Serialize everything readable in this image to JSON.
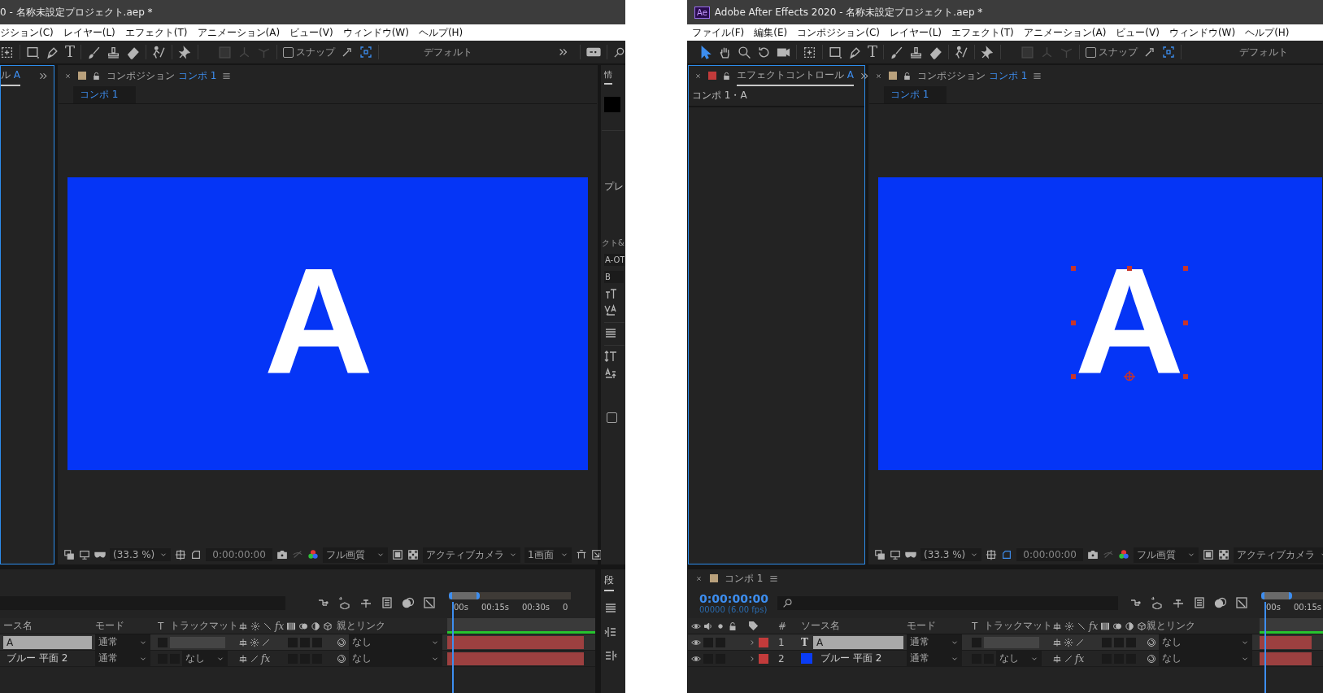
{
  "screens": [
    {
      "title": "0 - 名称未設定プロジェクト.aep *",
      "menu": [
        "ジション(C)",
        "レイヤー(L)",
        "エフェクト(T)",
        "アニメーション(A)",
        "ビュー(V)",
        "ウィンドウ(W)",
        "ヘルプ(H)"
      ],
      "tools": [
        {
          "kind": "region",
          "selected": false
        },
        {
          "kind": "rect",
          "selected": false
        },
        {
          "kind": "pen",
          "selected": false
        },
        {
          "kind": "type",
          "text": "T",
          "selected": false
        },
        {
          "kind": "brush",
          "selected": false
        },
        {
          "kind": "stamp",
          "selected": false
        },
        {
          "kind": "eraser",
          "selected": false
        },
        {
          "kind": "roto",
          "selected": false
        },
        {
          "kind": "pin",
          "selected": false
        }
      ],
      "snap": {
        "label": "スナップ",
        "checked": false
      },
      "workspace": "デフォルト",
      "left_panel": {
        "tab": "ル",
        "layer": "A",
        "active": true
      },
      "comp_tab": {
        "title": "コンポジション",
        "comp": "コンポ 1",
        "active": false
      },
      "comp_subtab": "コンポ 1",
      "layer_text": "A",
      "layer_selected": false,
      "viewer_bar": {
        "zoom": "(33.3 %)",
        "time": "0:00:00:00",
        "quality": "フル画質",
        "camera": "アクティブカメラ",
        "views": "1画面"
      },
      "side_panel": {
        "tab": "情",
        "preview": "プレ",
        "character": "クト&",
        "font": "A-OT",
        "style": "B",
        "option_checked": false,
        "paragraph": "段"
      },
      "timeline": {
        "columns": [
          {
            "kind": "name",
            "label": "ース名"
          },
          {
            "kind": "mode",
            "label": "モード"
          },
          {
            "kind": "t",
            "label": "T"
          },
          {
            "kind": "matte",
            "label": "トラックマット"
          },
          {
            "kind": "switches",
            "fx": "fx"
          },
          {
            "kind": "parent",
            "label": "親とリンク"
          }
        ],
        "ruler": [
          "00s",
          "00:15s",
          "00:30s",
          "0"
        ],
        "rows": [
          {
            "name": "A",
            "selected": true,
            "mode": "通常",
            "switches": [
              {
                "kind": "shy"
              },
              {
                "kind": "collapse"
              },
              {
                "kind": "quality"
              }
            ],
            "parent": "なし"
          },
          {
            "name": "ブルー 平面 2",
            "selected": false,
            "mode": "通常",
            "matte": "なし",
            "switches": [
              {
                "kind": "shy"
              },
              {
                "kind": "quality"
              }
            ],
            "fx": "fx",
            "parent": "なし"
          }
        ]
      }
    },
    {
      "app_badge": "Ae",
      "title": "Adobe After Effects 2020 - 名称未設定プロジェクト.aep *",
      "menu": [
        "ファイル(F)",
        "編集(E)",
        "コンポジション(C)",
        "レイヤー(L)",
        "エフェクト(T)",
        "アニメーション(A)",
        "ビュー(V)",
        "ウィンドウ(W)",
        "ヘルプ(H)"
      ],
      "tools": [
        {
          "kind": "select",
          "selected": true
        },
        {
          "kind": "hand",
          "selected": false
        },
        {
          "kind": "zoom",
          "selected": false
        },
        {
          "kind": "rotate",
          "selected": false
        },
        {
          "kind": "camera",
          "selected": false
        },
        {
          "kind": "region",
          "selected": false
        },
        {
          "kind": "rect",
          "selected": false
        },
        {
          "kind": "pen",
          "selected": false
        },
        {
          "kind": "type",
          "text": "T",
          "selected": false
        },
        {
          "kind": "brush",
          "selected": false
        },
        {
          "kind": "stamp",
          "selected": false
        },
        {
          "kind": "eraser",
          "selected": false
        },
        {
          "kind": "roto",
          "selected": false
        },
        {
          "kind": "pin",
          "selected": false
        }
      ],
      "snap": {
        "label": "スナップ",
        "checked": false
      },
      "workspace": "デフォルト",
      "left_panel": {
        "tab": "エフェクトコントロール",
        "layer": "A",
        "active": true,
        "subtitle": "コンポ 1・A"
      },
      "comp_tab": {
        "title": "コンポジション",
        "comp": "コンポ 1",
        "active": false
      },
      "comp_subtab": "コンポ 1",
      "layer_text": "A",
      "layer_selected": true,
      "viewer_bar": {
        "zoom": "(33.3 %)",
        "time": "0:00:00:00",
        "quality": "フル画質",
        "camera": "アクティブカメラ"
      },
      "timeline": {
        "tab": "コンポ 1",
        "timecode": "0:00:00:00",
        "fps": "00000 (6.00 fps)",
        "columns": [
          {
            "kind": "av"
          },
          {
            "kind": "label"
          },
          {
            "kind": "num",
            "label": "#"
          },
          {
            "kind": "name",
            "label": "ソース名"
          },
          {
            "kind": "mode",
            "label": "モード"
          },
          {
            "kind": "t",
            "label": "T"
          },
          {
            "kind": "matte",
            "label": "トラックマット"
          },
          {
            "kind": "switches",
            "fx": "fx"
          },
          {
            "kind": "parent",
            "label": "親とリンク"
          }
        ],
        "ruler": [
          "00s",
          "00:15s"
        ],
        "rows": [
          {
            "visible": true,
            "num": "1",
            "kind": "text",
            "type_text": "T",
            "name": "A",
            "selected": true,
            "mode": "通常",
            "switches": [
              {
                "kind": "shy"
              },
              {
                "kind": "collapse"
              },
              {
                "kind": "quality"
              }
            ],
            "parent": "なし"
          },
          {
            "visible": true,
            "num": "2",
            "kind": "solid",
            "color": "#0a3cf5",
            "name": "ブルー 平面 2",
            "selected": false,
            "mode": "通常",
            "matte": "なし",
            "switches": [
              {
                "kind": "shy"
              },
              {
                "kind": "quality"
              }
            ],
            "fx": "fx",
            "parent": "なし"
          }
        ]
      }
    }
  ]
}
